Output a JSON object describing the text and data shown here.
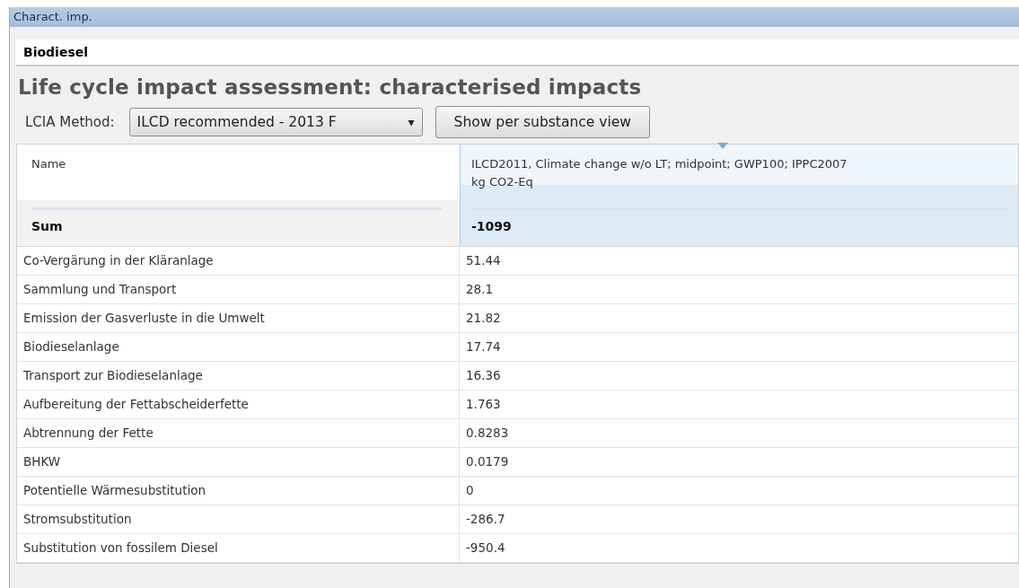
{
  "window": {
    "title": "Charact. imp."
  },
  "editor_tab": {
    "label": "Biodiesel"
  },
  "heading": "Life cycle impact assessment: characterised impacts",
  "method": {
    "label": "LCIA Method:",
    "value": "ILCD recommended - 2013 F",
    "caret": "▾"
  },
  "view_button": "Show per substance view",
  "table": {
    "columns": [
      {
        "header": "Name",
        "sum": "Sum",
        "selected": false
      },
      {
        "header": "ILCD2011, Climate change w/o LT; midpoint; GWP100; IPPC2007",
        "unit": "kg CO2-Eq",
        "sum": "-1099",
        "selected": true,
        "sorted": true
      }
    ],
    "rows": [
      [
        "Co-Vergärung in der Kläranlage",
        "51.44"
      ],
      [
        "Sammlung und Transport",
        "28.1"
      ],
      [
        "Emission der Gasverluste in die Umwelt",
        "21.82"
      ],
      [
        "Biodieselanlage",
        "17.74"
      ],
      [
        "Transport zur Biodieselanlage",
        "16.36"
      ],
      [
        "Aufbereitung der Fettabscheiderfette",
        "1.763"
      ],
      [
        "Abtrennung der Fette",
        "0.8283"
      ],
      [
        "BHKW",
        "0.0179"
      ],
      [
        "Potentielle Wärmesubstitution",
        "0"
      ],
      [
        "Stromsubstitution",
        "-286.7"
      ],
      [
        "Substitution von fossilem Diesel",
        "-950.4"
      ]
    ]
  }
}
